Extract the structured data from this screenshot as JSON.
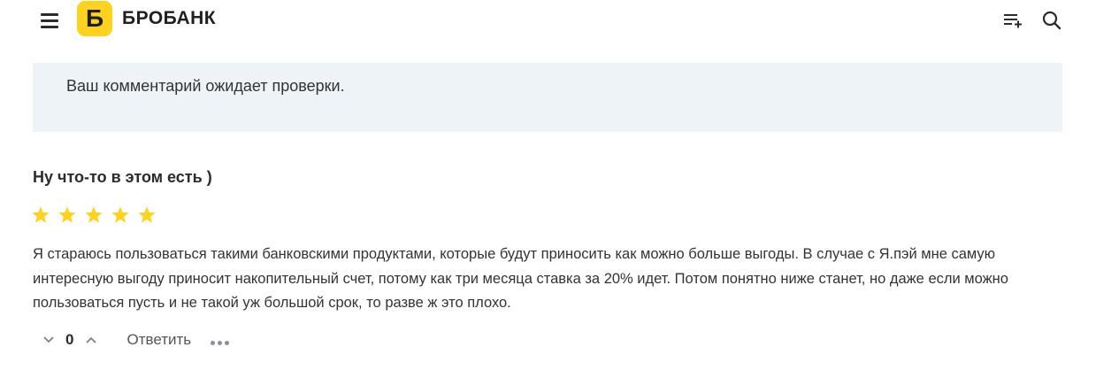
{
  "header": {
    "logo_letter": "Б",
    "logo_text": "БРОБАНК",
    "menu_icon": "hamburger-icon",
    "list_icon": "playlist-add-icon",
    "search_icon": "search-icon",
    "brand_color": "#ffd21e"
  },
  "notice": {
    "text": "Ваш комментарий ожидает проверки.",
    "background": "#eef3f7"
  },
  "comment": {
    "title": "Ну что-то в этом есть )",
    "rating": 5,
    "rating_max": 5,
    "star_color": "#ffd21e",
    "body": "Я стараюсь пользоваться такими банковскими продуктами, которые будут приносить как можно больше выгоды. В случае с Я.пэй мне самую интересную выгоду приносит накопительный счет, потому как три месяца ставка за 20% идет. Потом понятно ниже станет, но даже если можно пользоваться пусть и не такой уж большой срок, то разве ж это плохо.",
    "votes": "0",
    "reply_label": "Ответить",
    "more_icon": "more-dots-icon"
  }
}
